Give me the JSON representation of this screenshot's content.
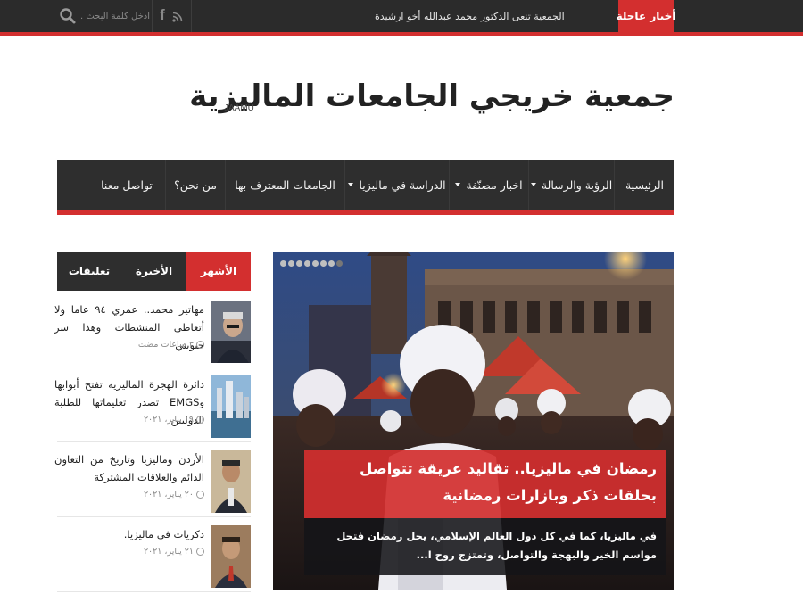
{
  "topbar": {
    "breaking_label": "أخبار عاجلة",
    "breaking_text": "الجمعية تنعى الدكتور محمد عبدالله أخو ارشيدة",
    "search_placeholder": "أدخل كلمة البحث ...",
    "facebook_glyph": "f"
  },
  "header": {
    "title": "جمعية خريجي الجامعات الماليزية",
    "abbr": "JAAMU"
  },
  "nav": {
    "items": [
      {
        "label": "الرئيسية",
        "has_dropdown": false
      },
      {
        "label": "الرؤية والرسالة",
        "has_dropdown": true
      },
      {
        "label": "اخبار مصنّفة",
        "has_dropdown": true
      },
      {
        "label": "الدراسة في ماليزيا",
        "has_dropdown": true
      },
      {
        "label": "الجامعات المعترف بها",
        "has_dropdown": false
      },
      {
        "label": "من نحن؟",
        "has_dropdown": false
      },
      {
        "label": "تواصل معنا",
        "has_dropdown": false
      }
    ]
  },
  "slider": {
    "title": "رمضان في ماليزيا.. تقاليد عريقة تتواصل بحلقات ذكر وبازارات رمضانية",
    "excerpt": "في ماليزيا، كما في كل دول العالم الإسلامي، يحل رمضان فتحل مواسم الخير والبهجة والتواصل، وتمتزج روح ا...",
    "dot_count": 8,
    "active_dot": 0
  },
  "sidebar": {
    "tabs": [
      {
        "label": "الأشهر",
        "active": true
      },
      {
        "label": "الأخيرة",
        "active": false
      },
      {
        "label": "تعليقات",
        "active": false
      }
    ],
    "posts": [
      {
        "title": "مهاتير محمد.. عمري ٩٤ عاما ولا أتعاطى المنشطات وهذا سر حيويتي",
        "date": "٣ ساعات مضت"
      },
      {
        "title": "دائرة الهجرة الماليزية تفتح أبوابها وEMGS تصدر تعليماتها للطلبة الدوليين",
        "date": "١٩ يناير، ٢٠٢١"
      },
      {
        "title": "الأردن وماليزيا وتاريخ من التعاون الدائم والعلاقات المشتركة",
        "date": "٢٠ يناير، ٢٠٢١"
      },
      {
        "title": "ذكريات في ماليزيا.",
        "date": "٢١ يناير، ٢٠٢١"
      }
    ]
  },
  "colors": {
    "accent": "#d32f2f",
    "dark": "#2e2e2e"
  }
}
